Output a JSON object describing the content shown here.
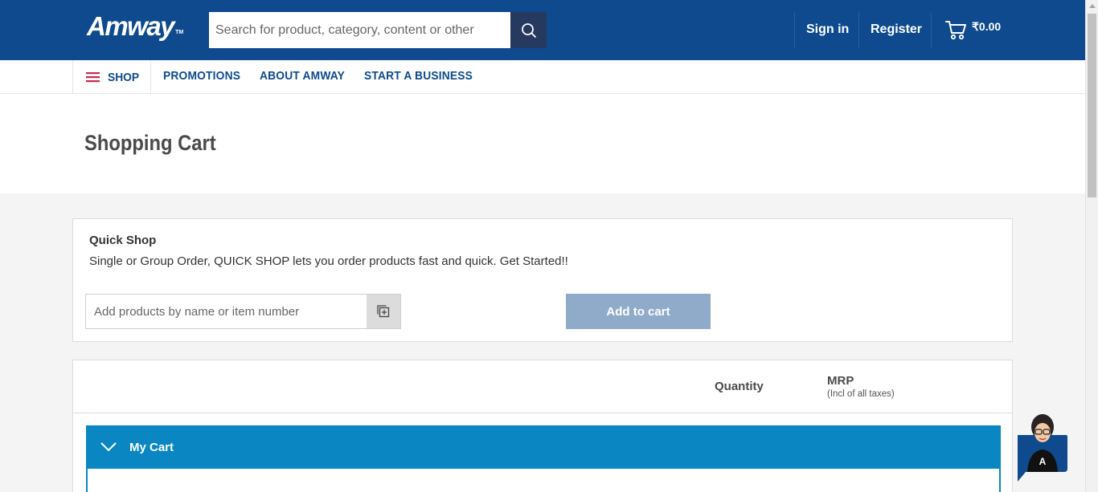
{
  "header": {
    "logo_text": "Amway",
    "logo_tm": "TM",
    "search_placeholder": "Search for product, category, content or other",
    "sign_in": "Sign in",
    "register": "Register",
    "cart_total": "₹0.00"
  },
  "nav": {
    "shop": "SHOP",
    "promotions": "PROMOTIONS",
    "about": "ABOUT AMWAY",
    "start_business": "START A BUSINESS"
  },
  "page": {
    "title": "Shopping Cart"
  },
  "quick_shop": {
    "title": "Quick Shop",
    "description": "Single or Group Order, QUICK SHOP lets you order products fast and quick. Get Started!!",
    "input_placeholder": "Add products by name or item number",
    "add_button": "Add to cart"
  },
  "cart": {
    "col_quantity": "Quantity",
    "col_mrp": "MRP",
    "col_mrp_note": "(Incl of all taxes)",
    "section_label": "My Cart"
  },
  "colors": {
    "header_bg": "#0e4a8d",
    "search_btn": "#26395e",
    "nav_text": "#0e4a8d",
    "menu_icon": "#c8264f",
    "add_cart_btn": "#8fabc9",
    "mycart_bar": "#0a87c3"
  },
  "icons": {
    "search": "search-icon",
    "cart": "cart-icon",
    "menu": "hamburger-icon",
    "quick_add": "add-to-list-icon",
    "collapse": "chevron-down-icon",
    "chat": "chat-assistant-avatar"
  }
}
